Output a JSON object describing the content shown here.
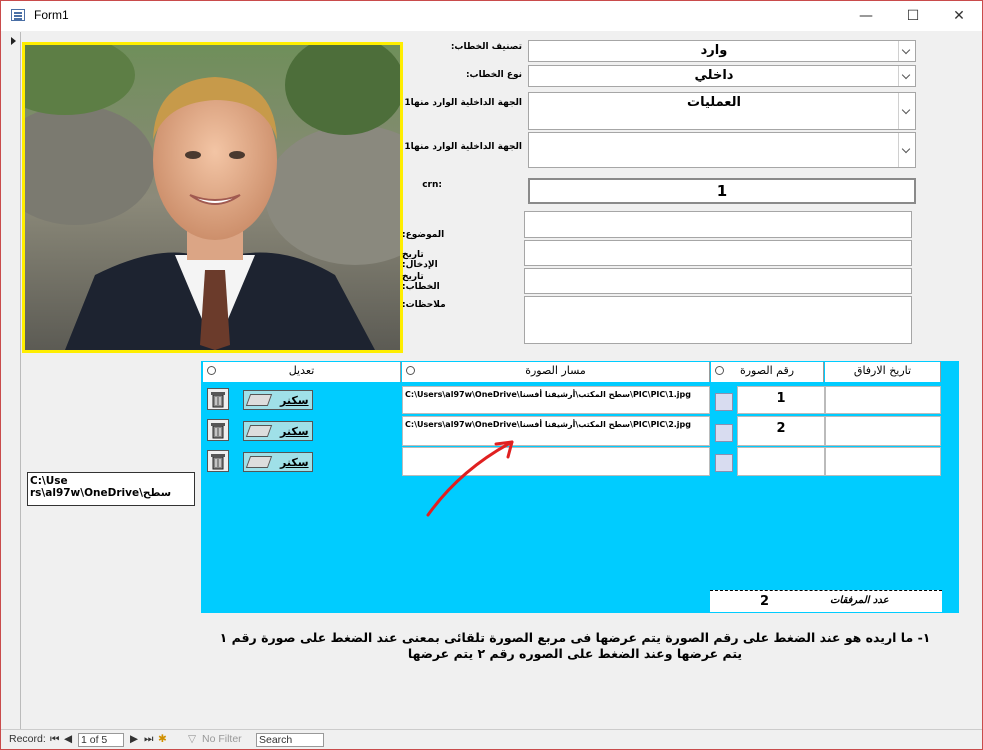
{
  "window": {
    "title": "Form1",
    "minimize": "—",
    "maximize": "☐",
    "close": "✕"
  },
  "fields": {
    "letter_class_label": "تصنيف الخطاب:",
    "letter_class_value": "وارد",
    "letter_type_label": "نوع الخطاب:",
    "letter_type_value": "داخلي",
    "dept1_label": "الجهة الداخلية الوارد منها1",
    "dept1_value": "العمليات",
    "dept2_label": "الجهة الداخلية الوارد منها1",
    "dept2_value": "",
    "crn_label": "crn:",
    "crn_value": "1",
    "subject_label": "الموضوع:",
    "entry_date_label": "تاريخ الإدخال:",
    "letter_date_label": "تاريخ الخطاب:",
    "notes_label": "ملاحظات:"
  },
  "path_box": "C:\\Use rs\\al97w\\OneDrive\\سطح",
  "subform": {
    "headers": {
      "edit": "تعديل",
      "path": "مسار الصورة",
      "num": "رقم الصورة",
      "date": "تاريخ الارفاق"
    },
    "scan_label": "سكنر",
    "rows": [
      {
        "path": "C:\\Users\\al97w\\OneDrive\\سطح المكتب\\أرشيفنا أفسنا\\PIC\\PIC\\1.jpg",
        "num": "1",
        "date": ""
      },
      {
        "path": "C:\\Users\\al97w\\OneDrive\\سطح المكتب\\أرشيفنا أفسنا\\PIC\\PIC\\2.jpg",
        "num": "2",
        "date": ""
      },
      {
        "path": "",
        "num": "",
        "date": ""
      }
    ],
    "count_label": "عدد المرفقات",
    "count_value": "2"
  },
  "note_line1": "١- ما اريده هو عند الضغط على رقم الصورة يتم عرضها فى مربع الصورة تلقائى بمعنى عند الضغط على صورة رقم ١",
  "note_line2": "يتم عرضها وعند الضغط على الصوره رقم ٢ يتم عرضها",
  "status": {
    "record_label": "Record:",
    "record_pos": "1 of 5",
    "no_filter": "No Filter",
    "search": "Search"
  },
  "colors": {
    "subform_bg": "#00ccff",
    "photo_border": "#ffee00",
    "arrow": "#e02020"
  }
}
